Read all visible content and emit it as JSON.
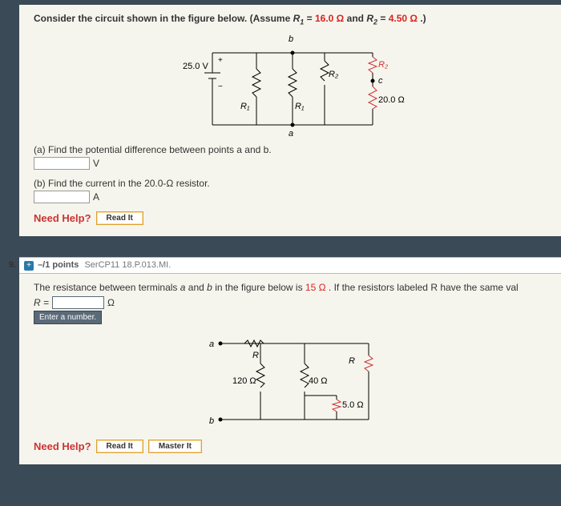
{
  "q8": {
    "intro_prefix": "Consider the circuit shown in the figure below. (Assume ",
    "r1_label": "R",
    "r1_sub": "1",
    "eq1": " = ",
    "r1_val": "16.0 Ω",
    "and_txt": " and ",
    "r2_label": "R",
    "r2_sub": "2",
    "eq2": " = ",
    "r2_val": "4.50 Ω",
    "close_paren": ".)",
    "circuit": {
      "voltage": "25.0 V",
      "node_b": "b",
      "node_a": "a",
      "node_c": "c",
      "R1": "R₁",
      "R2": "R₂",
      "r20": "20.0 Ω"
    },
    "part_a": "(a) Find the potential difference between points a and b.",
    "unit_a": "V",
    "part_b": "(b) Find the current in the 20.0-Ω resistor.",
    "unit_b": "A",
    "need_help": "Need Help?",
    "read_it": "Read It"
  },
  "q9": {
    "number": "9.",
    "points": "–/1 points",
    "source": "SerCP11 18.P.013.MI.",
    "line1_prefix": "The resistance between terminals ",
    "a_ital": "a",
    "and_txt": " and ",
    "b_ital": "b",
    "line1_mid": " in the figure below is ",
    "rab_val": "15 Ω",
    "line1_suffix": ". If the resistors labeled R have the same val",
    "R_label": "R = ",
    "R_unit": "Ω",
    "enter_tip": "Enter a number.",
    "circuit": {
      "node_a": "a",
      "node_b": "b",
      "R": "R",
      "r120": "120 Ω",
      "r40": "40 Ω",
      "r5": "5.0 Ω"
    },
    "need_help": "Need Help?",
    "read_it": "Read It",
    "master_it": "Master It"
  }
}
